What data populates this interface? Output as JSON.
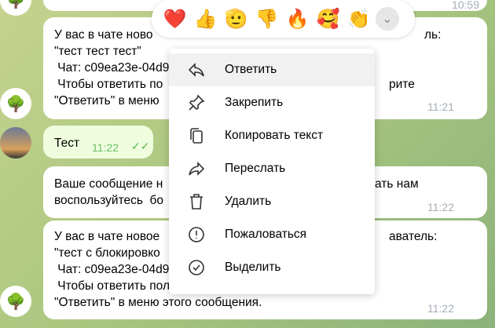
{
  "messages": [
    {
      "time": "10:59"
    },
    {
      "lines": [
        "У вас в чате ново",
        "\"тест тест тест\"",
        " Чат: c09ea23e-04d9",
        " Чтобы ответить по",
        "\"Ответить\" в меню "
      ],
      "line1_right": "ль:",
      "line4_right": "рите",
      "time": "11:21"
    },
    {
      "text": "Тест",
      "time": "11:22",
      "status": "read"
    },
    {
      "lines": [
        "Ваше сообщение н",
        "воспользуйтесь  бо"
      ],
      "line1_right": "ать нам",
      "time": "11:22"
    },
    {
      "lines": [
        "У вас в чате новое",
        "\"тест с блокировко",
        " Чат: c09ea23e-04d9",
        " Чтобы ответить пользователю на TutorOnline, выберите",
        "\"Ответить\" в меню этого сообщения."
      ],
      "line1_right": "аватель:",
      "time": "11:22"
    }
  ],
  "reactions": [
    "❤️",
    "👍",
    "🫡",
    "👎",
    "🔥",
    "🥰",
    "👏"
  ],
  "context_menu": [
    {
      "label": "Ответить",
      "icon": "reply-icon"
    },
    {
      "label": "Закрепить",
      "icon": "pin-icon"
    },
    {
      "label": "Копировать текст",
      "icon": "copy-icon"
    },
    {
      "label": "Переслать",
      "icon": "forward-icon"
    },
    {
      "label": "Удалить",
      "icon": "trash-icon"
    },
    {
      "label": "Пожаловаться",
      "icon": "report-icon"
    },
    {
      "label": "Выделить",
      "icon": "select-icon"
    }
  ]
}
